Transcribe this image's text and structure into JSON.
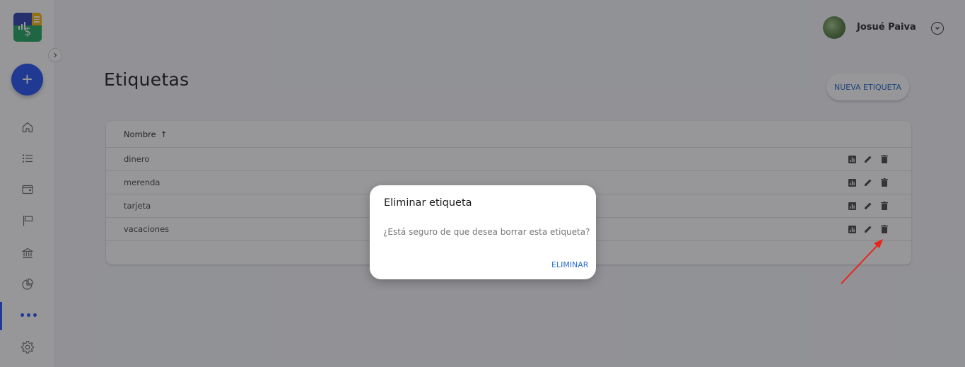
{
  "app": {
    "logo_symbol": "$"
  },
  "sidebar": {
    "fab_label": "+",
    "items": [
      {
        "icon": "home-icon"
      },
      {
        "icon": "list-icon"
      },
      {
        "icon": "wallet-icon"
      },
      {
        "icon": "flag-icon"
      },
      {
        "icon": "bank-icon"
      },
      {
        "icon": "pie-chart-icon"
      },
      {
        "icon": "more-icon",
        "label": "•••",
        "active": true
      },
      {
        "icon": "settings-icon"
      }
    ]
  },
  "header": {
    "user_name": "Josué Paiva"
  },
  "page": {
    "title": "Etiquetas",
    "new_button": "NUEVA ETIQUETA"
  },
  "table": {
    "header": {
      "column": "Nombre",
      "sort_arrow": "↑"
    },
    "rows": [
      {
        "name": "dinero"
      },
      {
        "name": "merenda"
      },
      {
        "name": "tarjeta"
      },
      {
        "name": "vacaciones"
      }
    ]
  },
  "dialog": {
    "title": "Eliminar etiqueta",
    "message": "¿Está seguro de que desea borrar esta etiqueta?",
    "confirm_button": "ELIMINAR"
  },
  "colors": {
    "accent": "#1f4ff0",
    "link": "#2d6bd0",
    "annotation": "#e8241c"
  }
}
